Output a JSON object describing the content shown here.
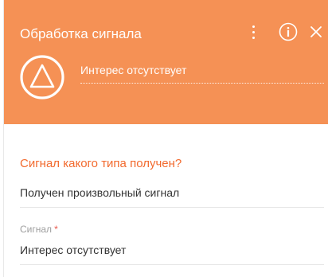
{
  "header": {
    "title": "Обработка сигнала",
    "status_value": "Интерес отсутствует",
    "background_color": "#f59155",
    "icons": {
      "menu": "kebab-menu-icon",
      "info": "info-circle-icon",
      "close": "close-icon",
      "status": "warning-triangle-icon"
    }
  },
  "form": {
    "section_title": "Сигнал какого типа получен?",
    "signal_type_value": "Получен произвольный сигнал",
    "signal_label": "Сигнал",
    "required_mark": "*",
    "signal_value": "Интерес отсутствует",
    "accent_color": "#f26a2e"
  }
}
